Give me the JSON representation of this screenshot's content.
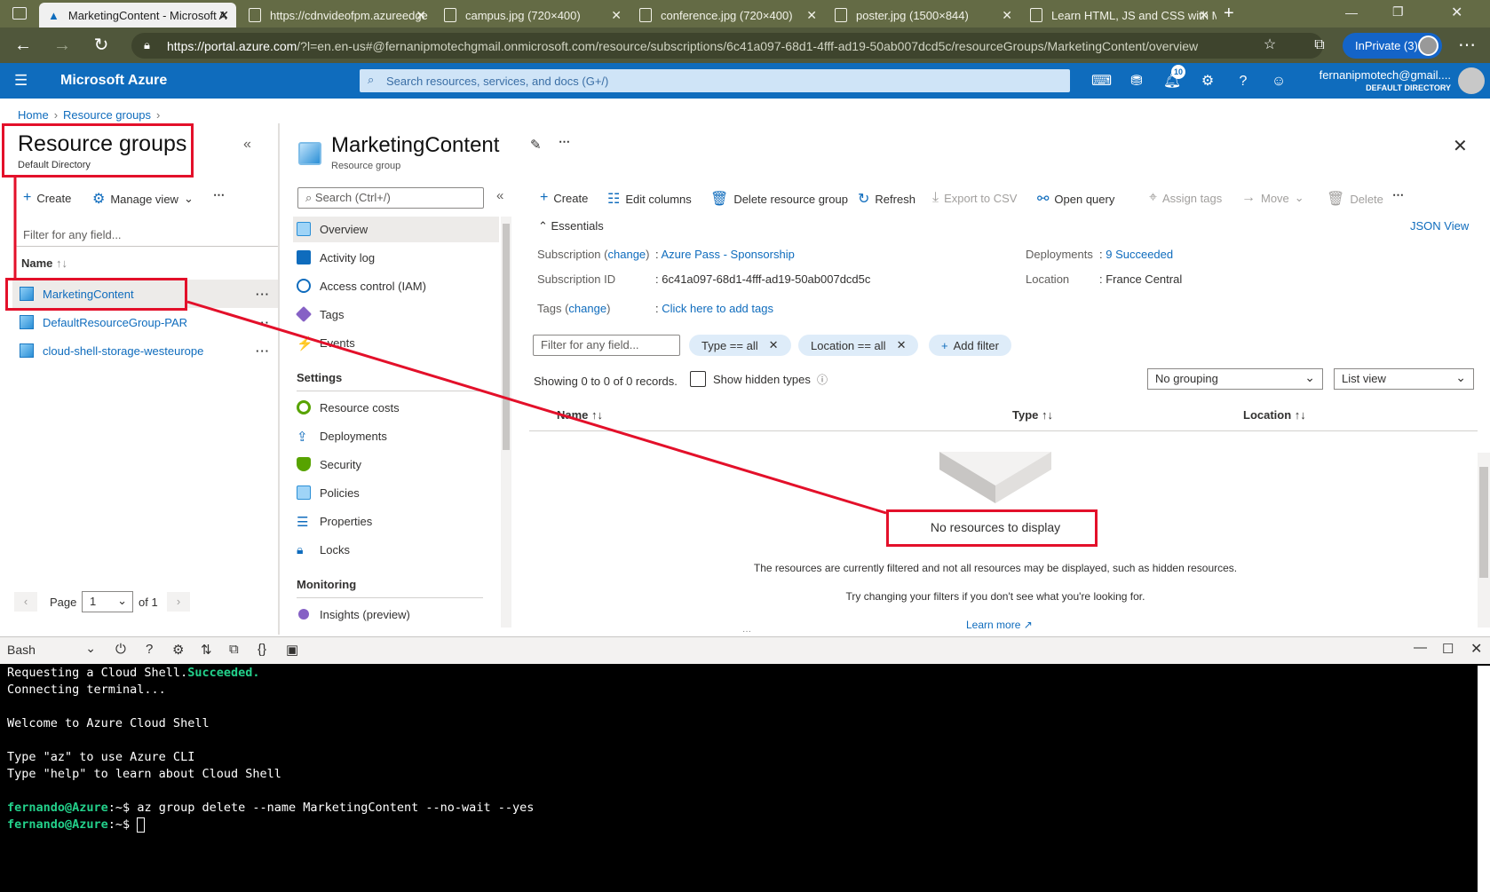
{
  "browser": {
    "tabs": [
      {
        "label": "MarketingContent - Microsoft A",
        "active": true
      },
      {
        "label": "https://cdnvideofpm.azureedge"
      },
      {
        "label": "campus.jpg (720×400)"
      },
      {
        "label": "conference.jpg (720×400)"
      },
      {
        "label": "poster.jpg (1500×844)"
      },
      {
        "label": "Learn HTML, JS and CSS with M"
      }
    ],
    "url_host": "https://portal.azure.com",
    "url_rest": "/?l=en.en-us#@fernanipmotechgmail.onmicrosoft.com/resource/subscriptions/6c41a097-68d1-4fff-ad19-50ab007dcd5c/resourceGroups/MarketingContent/overview",
    "inprivate": "InPrivate (3)"
  },
  "azure": {
    "brand": "Microsoft Azure",
    "search_placeholder": "Search resources, services, and docs (G+/)",
    "notifications_count": "10",
    "user_email": "fernanipmotech@gmail....",
    "user_directory": "DEFAULT DIRECTORY"
  },
  "breadcrumb": [
    "Home",
    "Resource groups"
  ],
  "left_blade": {
    "title": "Resource groups",
    "subtitle": "Default Directory",
    "create": "Create",
    "manage_view": "Manage view",
    "filter_placeholder": "Filter for any field...",
    "col_name": "Name",
    "items": [
      "MarketingContent",
      "DefaultResourceGroup-PAR",
      "cloud-shell-storage-westeurope"
    ],
    "page_label": "Page",
    "page_value": "1",
    "page_of": "of 1"
  },
  "resource_group": {
    "title": "MarketingContent",
    "subtitle": "Resource group",
    "search_placeholder": "Search (Ctrl+/)",
    "menu": [
      "Overview",
      "Activity log",
      "Access control (IAM)",
      "Tags",
      "Events"
    ],
    "settings_heading": "Settings",
    "settings": [
      "Resource costs",
      "Deployments",
      "Security",
      "Policies",
      "Properties",
      "Locks"
    ],
    "monitoring_heading": "Monitoring",
    "monitoring": [
      "Insights (preview)"
    ]
  },
  "toolbar": {
    "create": "Create",
    "edit_columns": "Edit columns",
    "delete_rg": "Delete resource group",
    "refresh": "Refresh",
    "export_csv": "Export to CSV",
    "open_query": "Open query",
    "assign_tags": "Assign tags",
    "move": "Move",
    "delete": "Delete"
  },
  "essentials": {
    "heading": "Essentials",
    "json_view": "JSON View",
    "subscription_label": "Subscription",
    "change": "change",
    "subscription_value": "Azure Pass - Sponsorship",
    "subscription_id_label": "Subscription ID",
    "subscription_id_value": "6c41a097-68d1-4fff-ad19-50ab007dcd5c",
    "tags_label": "Tags",
    "tags_value": "Click here to add tags",
    "deployments_label": "Deployments",
    "deployments_value": "9 Succeeded",
    "location_label": "Location",
    "location_value": "France Central"
  },
  "resources": {
    "filter_placeholder": "Filter for any field...",
    "type_filter": "Type == all",
    "location_filter": "Location == all",
    "add_filter": "Add filter",
    "showing": "Showing 0 to 0 of 0 records.",
    "show_hidden": "Show hidden types",
    "grouping": "No grouping",
    "view": "List view",
    "col_name": "Name",
    "col_type": "Type",
    "col_location": "Location",
    "empty_title": "No resources to display",
    "empty_line1": "The resources are currently filtered and not all resources may be displayed, such as hidden resources.",
    "empty_line2": "Try changing your filters if you don't see what you're looking for.",
    "learn_more": "Learn more"
  },
  "shell": {
    "mode": "Bash",
    "lines": {
      "l1a": "Requesting a Cloud Shell.",
      "l1b": "Succeeded.",
      "l2": "Connecting terminal...",
      "l3": "Welcome to Azure Cloud Shell",
      "l4": "Type \"az\" to use Azure CLI",
      "l5": "Type \"help\" to learn about Cloud Shell",
      "prompt": "fernando@Azure",
      "suffix": ":~$ ",
      "command": "az group delete --name MarketingContent --no-wait --yes"
    }
  },
  "colors": {
    "azure_blue": "#0f6cbd",
    "annotation_red": "#e3102a",
    "terminal_green": "#23d18b"
  }
}
